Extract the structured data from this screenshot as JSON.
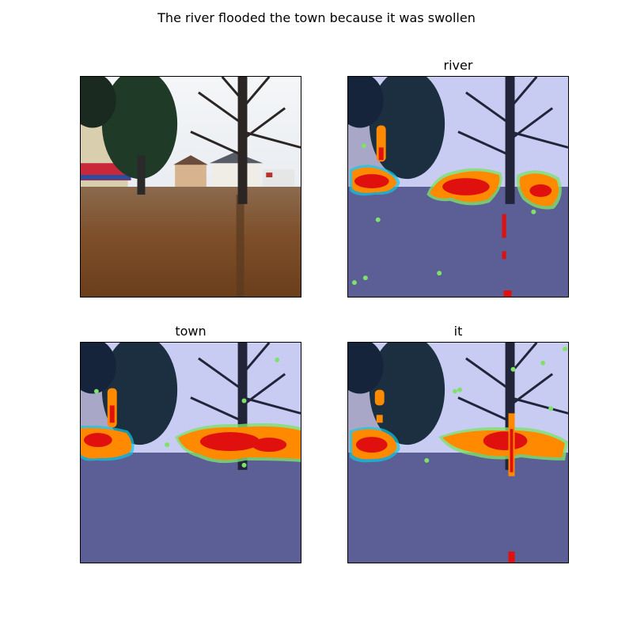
{
  "figure": {
    "title": "The river flooded the town because it was swollen"
  },
  "panels": [
    {
      "title": "",
      "kind": "original-photo"
    },
    {
      "title": "river",
      "kind": "attention-heatmap-overlay"
    },
    {
      "title": "town",
      "kind": "attention-heatmap-overlay"
    },
    {
      "title": "it",
      "kind": "attention-heatmap-overlay"
    }
  ],
  "colors": {
    "heat_hot": "#e0100f",
    "heat_mid": "#ff8a00",
    "heat_edge": "#7fe06a",
    "heat_rim": "#10c8e0",
    "water_brown": "#7a4a22",
    "water_overlay": "#5b5f95",
    "sky": "#e8ecf2",
    "sky_overlay": "#c3c8f0"
  }
}
